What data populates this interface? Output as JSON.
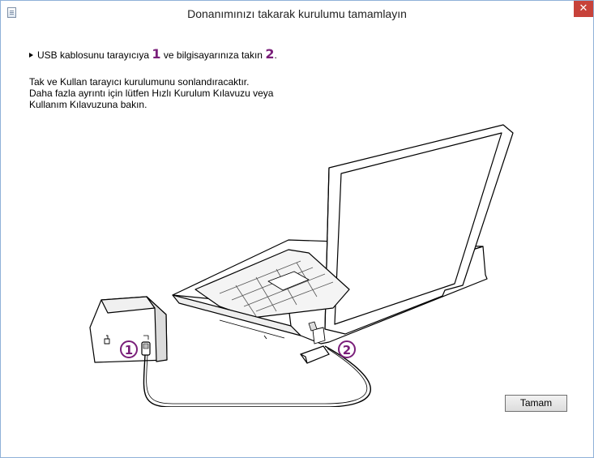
{
  "window": {
    "title": "Donanımınızı takarak kurulumu tamamlayın",
    "close_symbol": "✕"
  },
  "instruction": {
    "text_part1": "USB kablosunu tarayıcıya",
    "num1": "1",
    "text_part2": "ve bilgisayarınıza takın",
    "num2": "2",
    "text_end": "."
  },
  "description": {
    "line1": "Tak ve Kullan tarayıcı kurulumunu sonlandıracaktır.",
    "line2": "Daha fazla ayrıntı için lütfen Hızlı Kurulum Kılavuzu veya",
    "line3": "Kullanım Kılavuzuna bakın."
  },
  "illustration": {
    "marker1": "1",
    "marker2": "2",
    "accent_color": "#7a1f7a"
  },
  "buttons": {
    "ok_label": "Tamam"
  }
}
